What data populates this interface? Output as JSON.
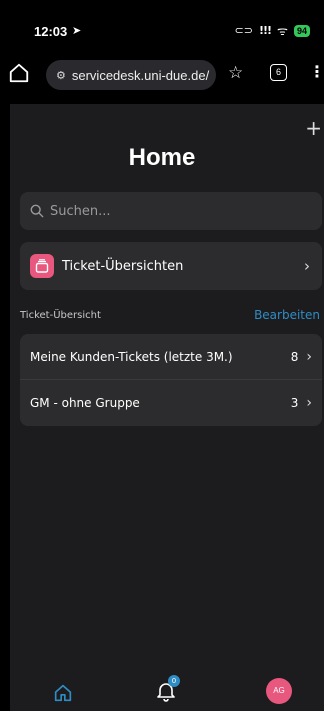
{
  "status_bar": {
    "time": "12:03",
    "location_icon": "location-arrow-icon",
    "link_glyph": "⊂⊃",
    "signal_glyph": "!!!",
    "wifi_glyph": "ᯤ",
    "battery": "94"
  },
  "browser": {
    "url": "servicedesk.uni-due.de/",
    "tab_count": "6",
    "menu_glyph": "⋮"
  },
  "app": {
    "title": "Home",
    "add_glyph": "+",
    "search_placeholder": "Suchen...",
    "overview_card_label": "Ticket-Übersichten",
    "section_title": "Ticket-Übersicht",
    "edit_label": "Bearbeiten",
    "rows": [
      {
        "label": "Meine Kunden-Tickets (letzte 3M.)",
        "count": "8"
      },
      {
        "label": "GM - ohne Gruppe",
        "count": "3"
      }
    ],
    "chevron_glyph": "›"
  },
  "nav": {
    "notifications_badge": "0",
    "avatar_initials": "AG"
  },
  "colors": {
    "accent": "#2f8dc4",
    "pink": "#e8577e",
    "battery_green": "#34c759",
    "app_bg": "#1c1c1e",
    "card_bg": "#2c2c2e"
  }
}
